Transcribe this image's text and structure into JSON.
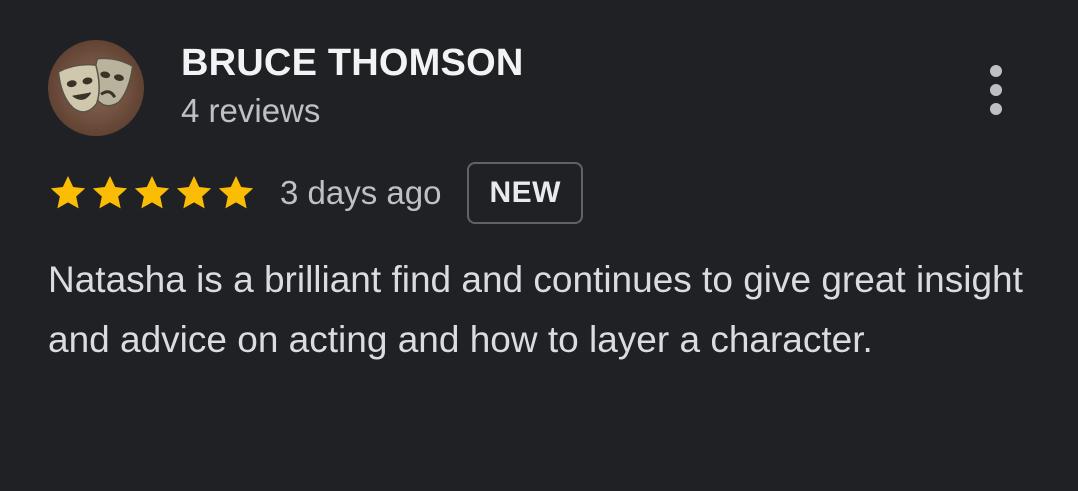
{
  "review": {
    "author_name": "BRUCE THOMSON",
    "review_count": "4 reviews",
    "rating": 5,
    "rating_max": 5,
    "date": "3 days ago",
    "badge": "NEW",
    "text": "Natasha is a brilliant find and continues to give great insight and advice on acting and how to layer a character."
  },
  "icons": {
    "star": "star-icon",
    "more": "more-vert-icon",
    "avatar": "theater-masks-avatar"
  },
  "colors": {
    "background": "#202124",
    "star": "#fbbc04",
    "primary_text": "#f1f3f4",
    "secondary_text": "#bdc1c6",
    "badge_border": "#5f6368"
  }
}
